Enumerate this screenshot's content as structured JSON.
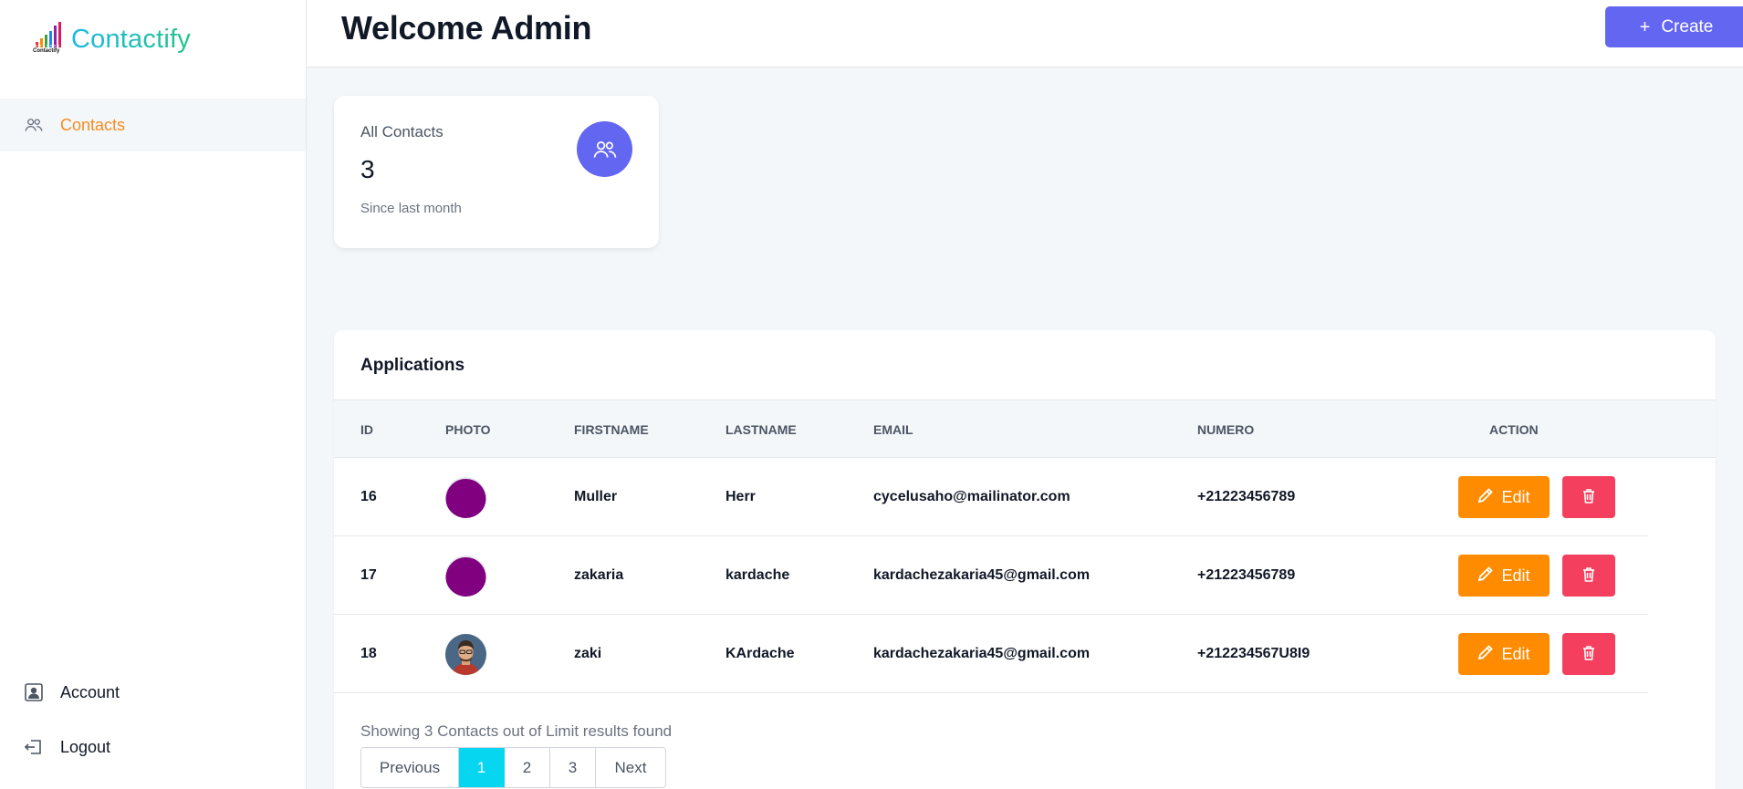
{
  "app": {
    "name": "Contactify",
    "logo_small_text": "Contactify"
  },
  "sidebar": {
    "items": [
      {
        "label": "Contacts",
        "icon": "users-icon",
        "active": true
      },
      {
        "label": "Account",
        "icon": "user-square-icon"
      },
      {
        "label": "Logout",
        "icon": "logout-icon"
      }
    ]
  },
  "header": {
    "title": "Welcome Admin",
    "create_label": "Create"
  },
  "stat": {
    "title": "All Contacts",
    "value": "3",
    "subtitle": "Since last month"
  },
  "table": {
    "title": "Applications",
    "columns": [
      "ID",
      "PHOTO",
      "FIRSTNAME",
      "LASTNAME",
      "EMAIL",
      "NUMERO",
      "ACTION"
    ],
    "rows": [
      {
        "id": "16",
        "photo": "purple-avatar",
        "firstname": "Muller",
        "lastname": "Herr",
        "email": "cycelusaho@mailinator.com",
        "numero": "+21223456789"
      },
      {
        "id": "17",
        "photo": "purple-avatar",
        "firstname": "zakaria",
        "lastname": "kardache",
        "email": "kardachezakaria45@gmail.com",
        "numero": "+21223456789"
      },
      {
        "id": "18",
        "photo": "person-avatar",
        "firstname": "zaki",
        "lastname": "KArdache",
        "email": "kardachezakaria45@gmail.com",
        "numero": "+212234567U8I9"
      }
    ],
    "edit_label": "Edit",
    "showing_text": "Showing 3 Contacts out of Limit results found",
    "pagination": {
      "previous": "Previous",
      "pages": [
        "1",
        "2",
        "3"
      ],
      "active": "1",
      "next": "Next"
    }
  },
  "colors": {
    "accent": "#6366f1",
    "edit": "#ff8c00",
    "delete": "#f43f5e",
    "active_nav": "#f68b1e",
    "page_active": "#06d6f0"
  }
}
